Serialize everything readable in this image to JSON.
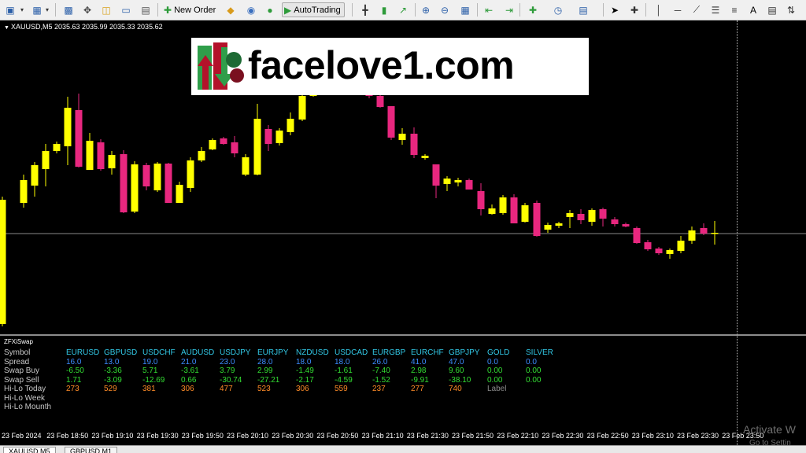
{
  "toolbar": {
    "new_order_label": "New Order",
    "autotrading_label": "AutoTrading",
    "icons": [
      "new-chart-icon",
      "profiles-icon",
      "zoom-window-icon",
      "crosshair-move-icon",
      "open-folder-icon",
      "navigator-icon",
      "data-window-icon",
      "new-order-icon",
      "gold-bars-icon",
      "market-watch-icon",
      "globe-icon",
      "autotrading-icon",
      "bar-chart-icon",
      "candlestick-icon",
      "line-chart-icon",
      "zoom-in-icon",
      "zoom-out-icon",
      "tile-windows-icon",
      "chart-shift-icon",
      "autoscroll-icon",
      "indicators-icon",
      "periods-icon",
      "templates-icon",
      "cursor-icon",
      "crosshair-icon",
      "trendline-icon",
      "text-icon",
      "arrows-icon"
    ]
  },
  "chart": {
    "symbol_line": "XAUUSD,M5  2035.63 2035.99 2035.33 2035.62",
    "bull_color": "#ffff00",
    "bear_color": "#e8277f",
    "bid_line_color": "#8a8a8a"
  },
  "banner": {
    "text": "facelove1.com",
    "logo_icon": "bull-bear-logo-icon"
  },
  "indicator": {
    "title": "ZFXiSwap",
    "row_labels": [
      "Symbol",
      "Spread",
      "Swap Buy",
      "Swap Sell",
      "Hi-Lo Today",
      "Hi-Lo Week",
      "Hi-Lo Mounth"
    ],
    "symbols": [
      "EURUSD",
      "GBPUSD",
      "USDCHF",
      "AUDUSD",
      "USDJPY",
      "EURJPY",
      "NZDUSD",
      "USDCAD",
      "EURGBP",
      "EURCHF",
      "GBPJPY",
      "GOLD",
      "SILVER"
    ],
    "spread": [
      "16.0",
      "13.0",
      "19.0",
      "21.0",
      "23.0",
      "28.0",
      "18.0",
      "18.0",
      "26.0",
      "41.0",
      "47.0",
      "0.0",
      "0.0"
    ],
    "swap_buy": [
      "-6.50",
      "-3.36",
      "5.71",
      "-3.61",
      "3.79",
      "2.99",
      "-1.49",
      "-1.61",
      "-7.40",
      "2.98",
      "9.60",
      "0.00",
      "0.00"
    ],
    "swap_sell": [
      "1.71",
      "-3.09",
      "-12.69",
      "0.66",
      "-30.74",
      "-27.21",
      "-2.17",
      "-4.59",
      "-1.52",
      "-9.91",
      "-38.10",
      "0.00",
      "0.00"
    ],
    "hilo_today": [
      "273",
      "529",
      "381",
      "306",
      "477",
      "523",
      "306",
      "559",
      "237",
      "277",
      "740",
      "Label",
      ""
    ],
    "colors": {
      "symbol": "#32c8e6",
      "spread": "#3c8cff",
      "swap": "#32dc32",
      "hilo": "#ff8c28",
      "label": "#8c8c8c"
    }
  },
  "time_axis": [
    "23 Feb 2024",
    "23 Feb 18:50",
    "23 Feb 19:10",
    "23 Feb 19:30",
    "23 Feb 19:50",
    "23 Feb 20:10",
    "23 Feb 20:30",
    "23 Feb 20:50",
    "23 Feb 21:10",
    "23 Feb 21:30",
    "23 Feb 21:50",
    "23 Feb 22:10",
    "23 Feb 22:30",
    "23 Feb 22:50",
    "23 Feb 23:10",
    "23 Feb 23:30",
    "23 Feb 23:50"
  ],
  "tabs": [
    "XAUUSD,M5",
    "GBPUSD,M1"
  ],
  "watermark": {
    "line1": "Activate W",
    "line2": "Go to Settin"
  }
}
